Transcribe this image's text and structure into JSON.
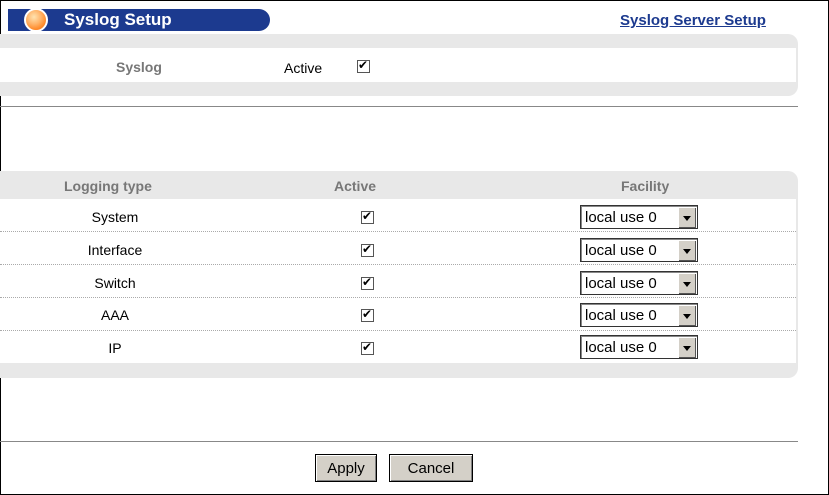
{
  "header": {
    "title": "Syslog Setup",
    "server_link": "Syslog Server Setup"
  },
  "syslog": {
    "label": "Syslog",
    "active_label": "Active",
    "active_checked": true
  },
  "logging_table": {
    "headers": [
      "Logging type",
      "Active",
      "Facility"
    ],
    "rows": [
      {
        "type": "System",
        "active": true,
        "facility": "local use 0"
      },
      {
        "type": "Interface",
        "active": true,
        "facility": "local use 0"
      },
      {
        "type": "Switch",
        "active": true,
        "facility": "local use 0"
      },
      {
        "type": "AAA",
        "active": true,
        "facility": "local use 0"
      },
      {
        "type": "IP",
        "active": true,
        "facility": "local use 0"
      }
    ]
  },
  "buttons": {
    "apply": "Apply",
    "cancel": "Cancel"
  },
  "colors": {
    "title_bar": "#1c3a8f",
    "panel_gray": "#e8e8e8"
  }
}
